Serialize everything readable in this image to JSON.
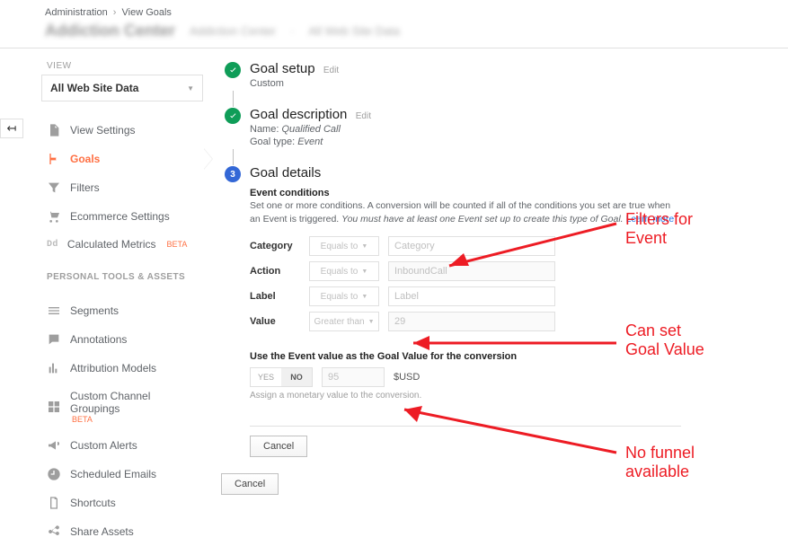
{
  "breadcrumb": {
    "a": "Administration",
    "b": "View Goals"
  },
  "blur": {
    "a": "Addiction Center",
    "b": "Addiction Center",
    "c": "All Web Site Data"
  },
  "side": {
    "view_label": "VIEW",
    "view_value": "All Web Site Data",
    "section2": "PERSONAL TOOLS & ASSETS",
    "beta": "BETA",
    "items": {
      "view_settings": "View Settings",
      "goals": "Goals",
      "filters": "Filters",
      "ecom": "Ecommerce Settings",
      "calc": "Calculated Metrics",
      "segments": "Segments",
      "annotations": "Annotations",
      "attribution": "Attribution Models",
      "ccg": "Custom Channel Groupings",
      "alerts": "Custom Alerts",
      "sched": "Scheduled Emails",
      "shortcuts": "Shortcuts",
      "share": "Share Assets"
    }
  },
  "steps": {
    "setup": {
      "title": "Goal setup",
      "edit": "Edit",
      "sub": "Custom"
    },
    "desc": {
      "title": "Goal description",
      "edit": "Edit",
      "name_lbl": "Name:",
      "name_val": "Qualified Call",
      "type_lbl": "Goal type:",
      "type_val": "Event"
    },
    "details": {
      "num": "3",
      "title": "Goal details"
    }
  },
  "event": {
    "heading": "Event conditions",
    "text1": "Set one or more conditions. A conversion will be counted if all of the conditions you set are true when an Event is triggered. ",
    "text2": "You must have at least one Event set up to create this type of Goal.",
    "learn": "Learn more",
    "rows": {
      "category": {
        "label": "Category",
        "op": "Equals to",
        "val": "Category"
      },
      "action": {
        "label": "Action",
        "op": "Equals to",
        "val": "InboundCall"
      },
      "label_": {
        "label": "Label",
        "op": "Equals to",
        "val": "Label"
      },
      "value": {
        "label": "Value",
        "op": "Greater than",
        "val": "29"
      }
    }
  },
  "goalvalue": {
    "heading": "Use the Event value as the Goal Value for the conversion",
    "yes": "YES",
    "no": "NO",
    "val": "95",
    "usd": "$USD",
    "hint": "Assign a monetary value to the conversion."
  },
  "buttons": {
    "cancel": "Cancel"
  },
  "anno": {
    "a": "Filters for\nEvent",
    "b": "Can set\nGoal Value",
    "c": "No funnel\navailable"
  }
}
